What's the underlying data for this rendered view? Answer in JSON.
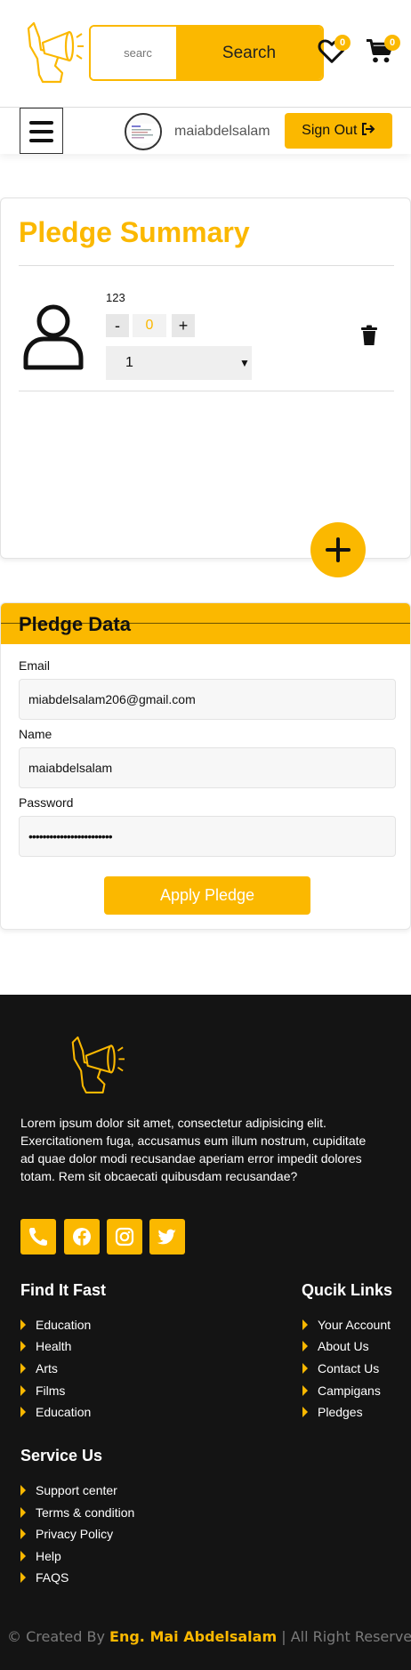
{
  "header": {
    "search_placeholder": "searc",
    "search_button": "Search",
    "wishlist_count": "0",
    "cart_count": "0"
  },
  "navbar": {
    "username": "maiabdelsalam",
    "signout_label": "Sign Out"
  },
  "summary": {
    "title": "Pledge Summary",
    "item": {
      "name": "123",
      "minus": "-",
      "quantity": "0",
      "plus": "+",
      "selected_option": "1"
    }
  },
  "pledge_data": {
    "title": "Pledge Data",
    "email_label": "Email",
    "email_value": "miabdelsalam206@gmail.com",
    "name_label": "Name",
    "name_value": "maiabdelsalam",
    "password_label": "Password",
    "password_value": "••••••••••••••••••••••••",
    "apply_button": "Apply Pledge"
  },
  "footer": {
    "about": "Lorem ipsum dolor sit amet, consectetur adipisicing elit. Exercitationem fuga, accusamus eum illum nostrum, cupiditate ad quae dolor modi recusandae aperiam error impedit dolores totam. Rem sit obcaecati quibusdam recusandae?",
    "find_title": "Find It Fast",
    "find_links": [
      "Education",
      "Health",
      "Arts",
      "Films",
      "Education"
    ],
    "quick_title": "Qucik Links",
    "quick_links": [
      "Your Account",
      "About Us",
      "Contact Us",
      "Campigans",
      "Pledges"
    ],
    "service_title": "Service Us",
    "service_links": [
      "Support center",
      "Terms & condition",
      "Privacy Policy",
      "Help",
      "FAQS"
    ],
    "copyright_prefix": "© Created By ",
    "copyright_author": "Eng. Mai Abdelsalam",
    "copyright_suffix": " | All Right Reserved"
  },
  "colors": {
    "accent": "#fbb800",
    "footer_bg": "#141414"
  },
  "icons": [
    "megaphone-logo-icon",
    "heart-icon",
    "cart-icon",
    "menu-icon",
    "sign-out-icon",
    "user-icon",
    "trash-icon",
    "plus-icon",
    "phone-icon",
    "facebook-icon",
    "instagram-icon",
    "twitter-icon"
  ]
}
